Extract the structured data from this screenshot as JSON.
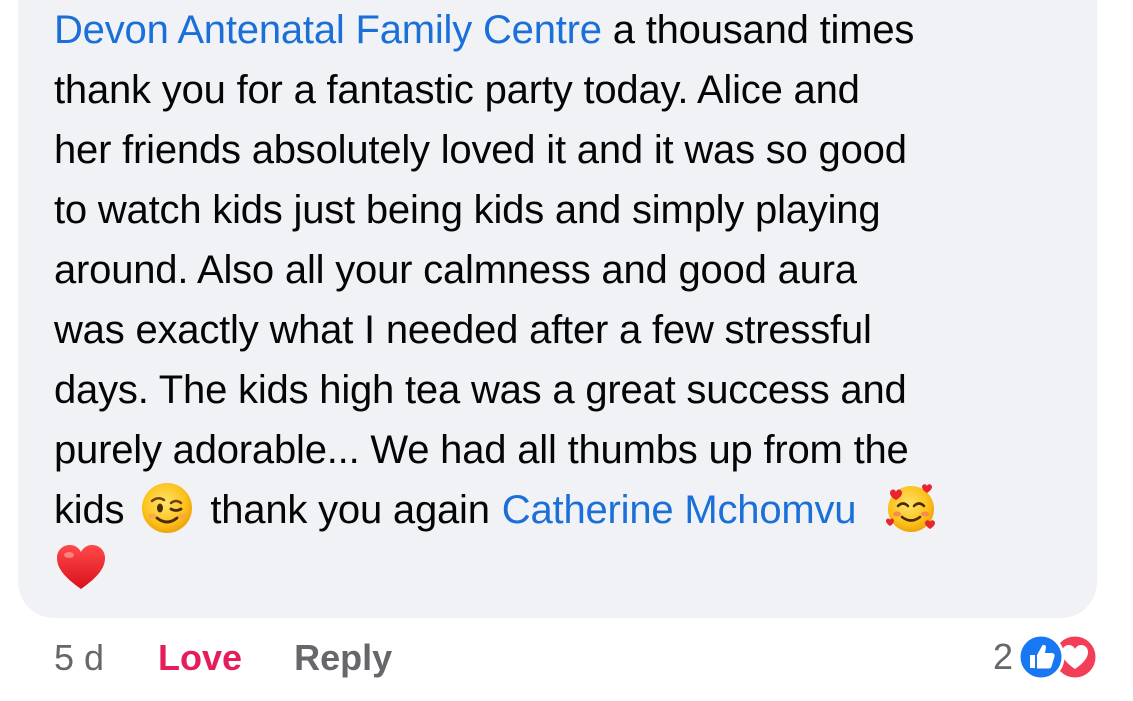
{
  "comment": {
    "author": "Devon Antenatal Family Centre",
    "lines": [
      " a thousand times",
      "thank you for a fantastic party today. Alice and",
      "her friends absolutely loved it and it was so good",
      "to watch kids just being kids and simply playing",
      "around. Also all your calmness and good aura",
      "was exactly what I needed after a few stressful",
      "days. The kids high tea was a great success and",
      "purely adorable... We had all thumbs up from the"
    ],
    "last_line_prefix": "kids",
    "last_line_middle": "thank you again",
    "mention": "Catherine Mchomvu",
    "emojis": [
      "winking-face",
      "smiling-face-with-hearts",
      "red-heart"
    ]
  },
  "actions": {
    "time": "5 d",
    "love_label": "Love",
    "reply_label": "Reply"
  },
  "reactions": {
    "count": "2",
    "types": [
      "like",
      "love"
    ]
  },
  "colors": {
    "bubble": "#f0f2f5",
    "mention": "#1a6fd9",
    "love": "#e41e5a",
    "meta": "#65676b",
    "like_icon": "#1877f2",
    "love_icon": "#f33e58"
  }
}
